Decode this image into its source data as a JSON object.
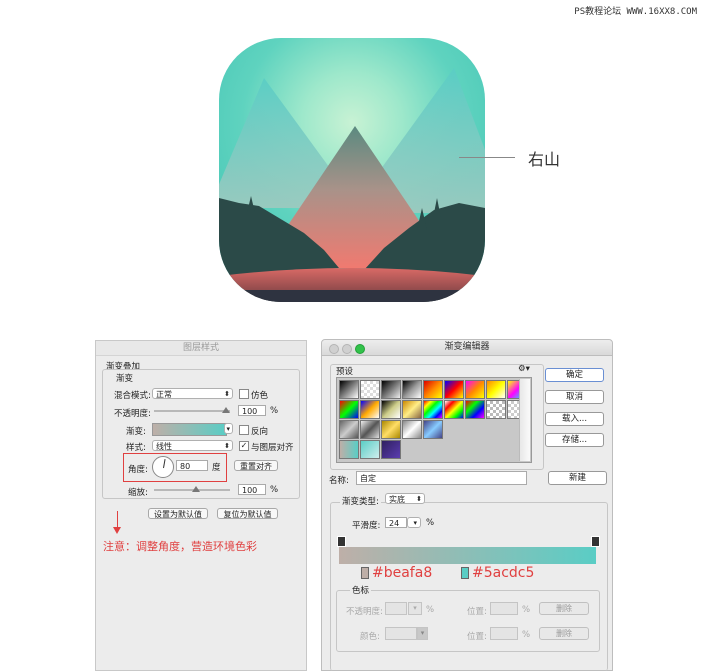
{
  "watermark": "PS教程论坛 WWW.16XX8.COM",
  "annotation": {
    "label": "右山"
  },
  "layer_style": {
    "window_title": "图层样式",
    "section_title": "渐变叠加",
    "group_title": "渐变",
    "blend_mode_label": "混合模式:",
    "blend_mode_value": "正常",
    "dither_label": "仿色",
    "opacity_label": "不透明度:",
    "opacity_value": "100",
    "opacity_unit": "%",
    "gradient_label": "渐变:",
    "reverse_label": "反向",
    "style_label": "样式:",
    "style_value": "线性",
    "align_label": "与图层对齐",
    "align_checked": "✓",
    "angle_label": "角度:",
    "angle_value": "80",
    "angle_unit": "度",
    "reset_align_button": "重置对齐",
    "scale_label": "缩放:",
    "scale_value": "100",
    "scale_unit": "%",
    "set_default_button": "设置为默认值",
    "reset_default_button": "复位为默认值",
    "note": "注意：调整角度，营造环境色彩"
  },
  "gradient_editor": {
    "window_title": "渐变编辑器",
    "presets_title": "预设",
    "gear": "⚙▾",
    "ok_button": "确定",
    "cancel_button": "取消",
    "load_button": "载入...",
    "save_button": "存储...",
    "name_label": "名称:",
    "name_value": "自定",
    "new_button": "新建",
    "type_label": "渐变类型:",
    "type_value": "实底",
    "smoothness_label": "平滑度:",
    "smoothness_value": "24",
    "smoothness_unit": "%",
    "left_color": "#beafa8",
    "right_color": "#5acdc5",
    "stops_title": "色标",
    "stop_opacity_label": "不透明度:",
    "stop_opacity_unit": "%",
    "position_label": "位置:",
    "position_unit": "%",
    "delete_button": "删除",
    "color_label": "颜色:"
  },
  "colors": {
    "gradient_start": "#beafa8",
    "gradient_end": "#5acdc5",
    "annotation_red": "#e04040"
  }
}
